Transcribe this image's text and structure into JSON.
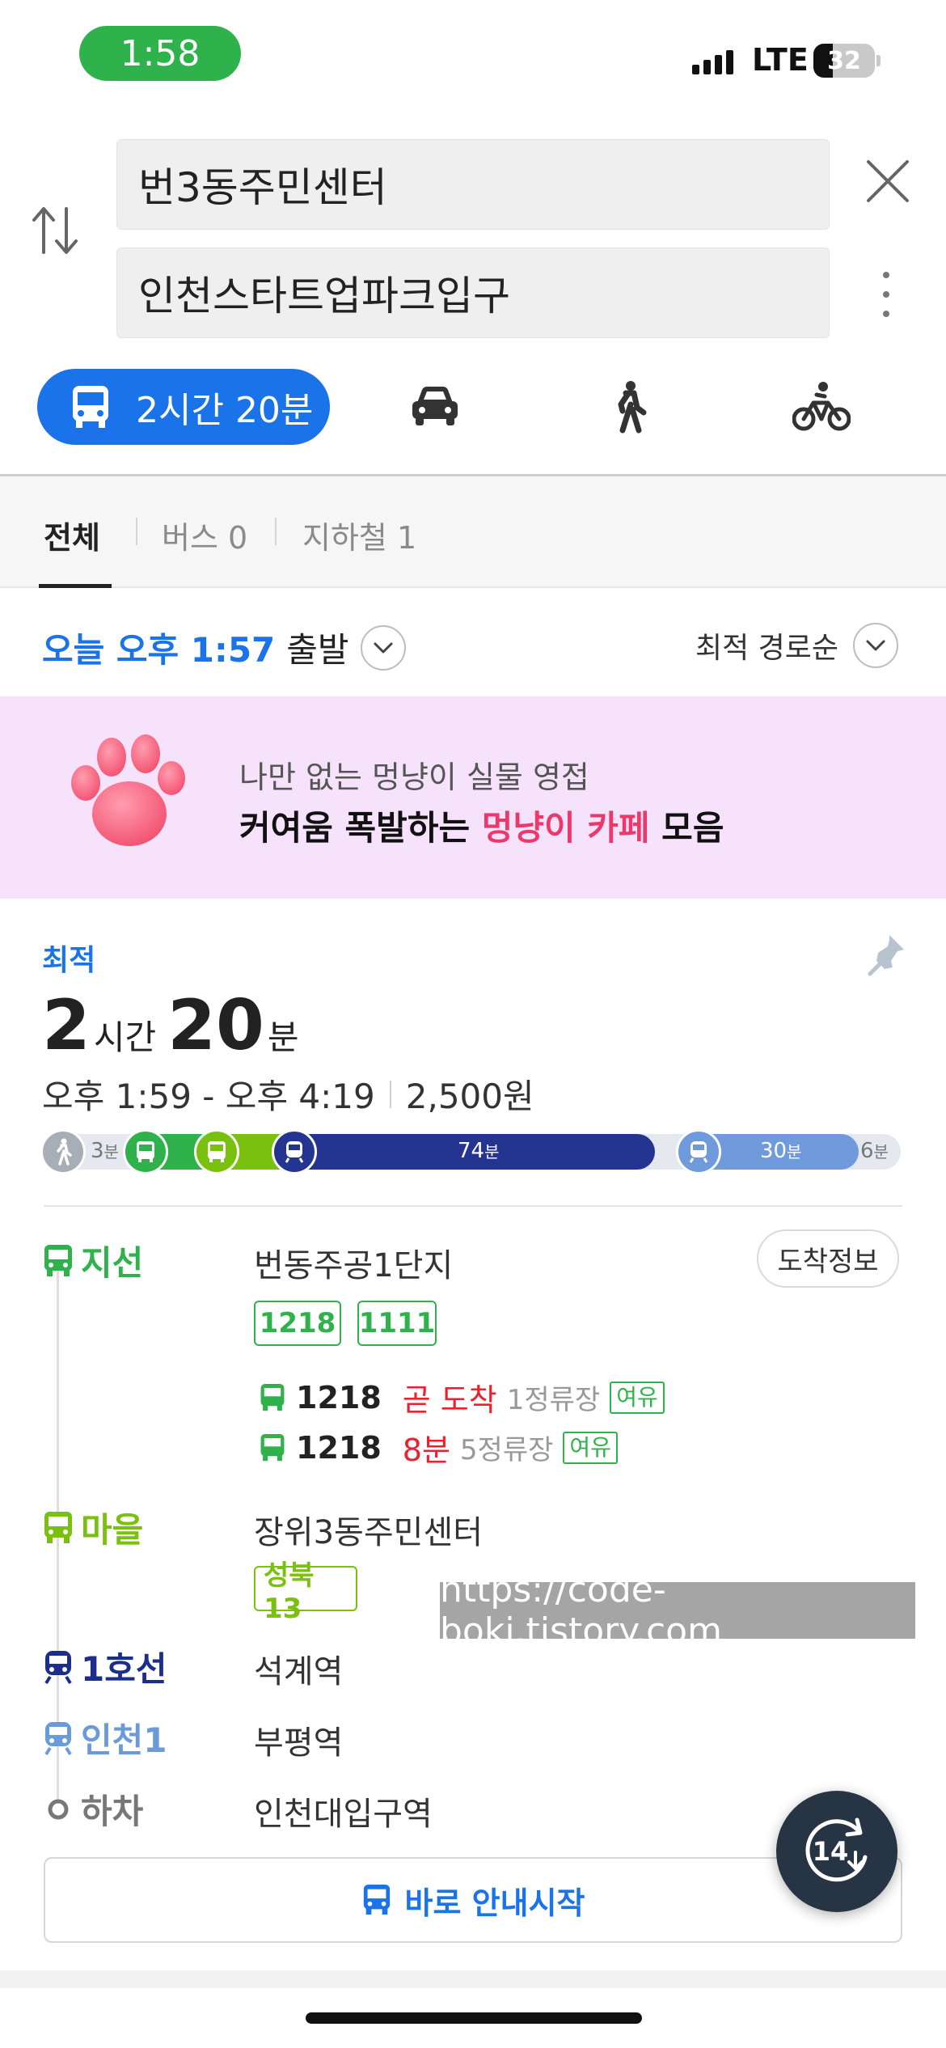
{
  "status": {
    "time": "1:58",
    "network": "LTE",
    "battery": "32",
    "battery_level": 0.32
  },
  "search": {
    "origin": "번3동주민센터",
    "destination": "인천스타트업파크입구"
  },
  "modes": {
    "active_label": "2시간 20분",
    "items": [
      "bus-icon",
      "car-icon",
      "walk-icon",
      "bike-icon"
    ]
  },
  "tabs": [
    {
      "label": "전체"
    },
    {
      "label": "버스 0"
    },
    {
      "label": "지하철 1"
    }
  ],
  "depart": {
    "time": "오늘 오후 1:57",
    "suffix": "출발",
    "sort": "최적 경로순"
  },
  "banner": {
    "line1": "나만 없는 멍냥이 실물 영접",
    "line2_a": "커여움 폭발하는 ",
    "line2_b": "멍냥이 카페",
    "line2_c": " 모음"
  },
  "route": {
    "tag": "최적",
    "hours": "2",
    "hours_unit": "시간",
    "minutes": "20",
    "minutes_unit": "분",
    "time_range": "오후 1:59 - 오후 4:19",
    "fare": "2,500원",
    "segments": {
      "walk1": "3",
      "unit": "분",
      "subway1": "74",
      "subway2": "30",
      "walk2": "6"
    },
    "arrival_info_label": "도착정보",
    "steps": [
      {
        "mode": "지선",
        "stop": "번동주공1단지",
        "color": "#2fb24c"
      },
      {
        "mode": "마을",
        "stop": "장위3동주민센터",
        "color": "#7ac10f"
      },
      {
        "mode": "1호선",
        "stop": "석계역",
        "color": "#1b2f8a"
      },
      {
        "mode": "인천1",
        "stop": "부평역",
        "color": "#6b9ad8"
      },
      {
        "mode": "하차",
        "stop": "인천대입구역",
        "color": "#777777"
      }
    ],
    "chips_step1": [
      "1218",
      "1111"
    ],
    "chip_step2": "성북13",
    "arrivals": [
      {
        "route": "1218",
        "eta": "곧 도착",
        "stops": "1정류장",
        "seat": "여유"
      },
      {
        "route": "1218",
        "eta": "8분",
        "stops": "5정류장",
        "seat": "여유"
      }
    ],
    "start_label": "바로 안내시작"
  },
  "watermark": "https://code-boki.tistory.com",
  "refresh_count": "14"
}
